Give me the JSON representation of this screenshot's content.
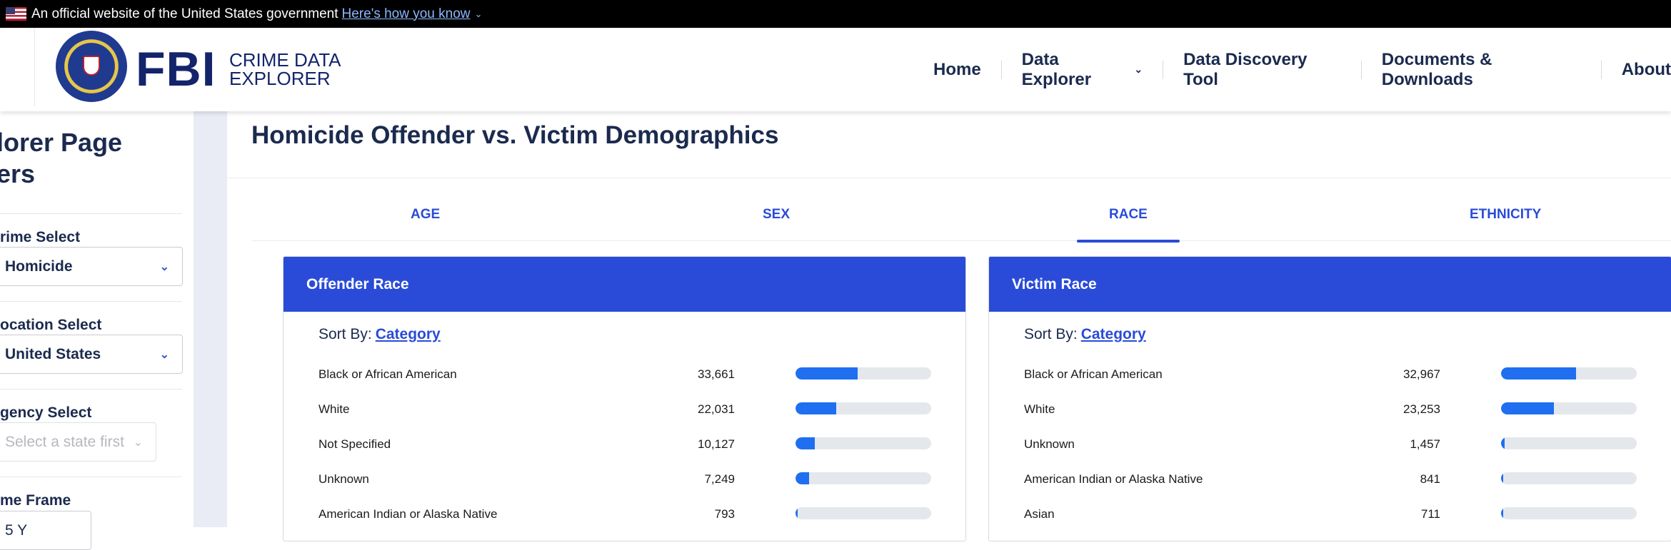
{
  "gov_banner": {
    "text": "An official website of the United States government",
    "link": "Here's how you know"
  },
  "header": {
    "logo_main": "FBI",
    "logo_sub_1": "CRIME DATA",
    "logo_sub_2": "EXPLORER",
    "nav": [
      {
        "label": "Home"
      },
      {
        "label": "Data Explorer"
      },
      {
        "label": "Data Discovery Tool"
      },
      {
        "label": "Documents & Downloads"
      },
      {
        "label": "About"
      }
    ]
  },
  "sidebar": {
    "title_line1": "lorer Page",
    "title_line2": "ers",
    "crime_label": "rime Select",
    "crime_value": "Homicide",
    "location_label": "ocation Select",
    "location_value": "United States",
    "agency_label": "gency Select",
    "agency_placeholder": "Select a state first",
    "timeframe_label": "me Frame",
    "timeframe_value": "5 Y"
  },
  "main": {
    "title": "Homicide Offender vs. Victim Demographics",
    "tabs": [
      {
        "label": "AGE"
      },
      {
        "label": "SEX"
      },
      {
        "label": "RACE"
      },
      {
        "label": "ETHNICITY"
      }
    ],
    "active_tab": "RACE"
  },
  "offender_card": {
    "title": "Offender Race",
    "sort_prefix": "Sort By:",
    "sort_link": "Category",
    "rows": [
      {
        "label": "Black or African American",
        "value": "33,661",
        "fraction": 0.46
      },
      {
        "label": "White",
        "value": "22,031",
        "fraction": 0.3
      },
      {
        "label": "Not Specified",
        "value": "10,127",
        "fraction": 0.14
      },
      {
        "label": "Unknown",
        "value": "7,249",
        "fraction": 0.1
      },
      {
        "label": "American Indian or Alaska Native",
        "value": "793",
        "fraction": 0.012
      }
    ]
  },
  "victim_card": {
    "title": "Victim Race",
    "sort_prefix": "Sort By:",
    "sort_link": "Category",
    "rows": [
      {
        "label": "Black or African American",
        "value": "32,967",
        "fraction": 0.55
      },
      {
        "label": "White",
        "value": "23,253",
        "fraction": 0.39
      },
      {
        "label": "Unknown",
        "value": "1,457",
        "fraction": 0.024
      },
      {
        "label": "American Indian or Alaska Native",
        "value": "841",
        "fraction": 0.014
      },
      {
        "label": "Asian",
        "value": "711",
        "fraction": 0.012
      }
    ]
  },
  "colors": {
    "accent": "#2a4bd8",
    "bar_fill": "#1f6ff0",
    "bar_track": "#e4e7ec",
    "navy": "#14246b"
  }
}
